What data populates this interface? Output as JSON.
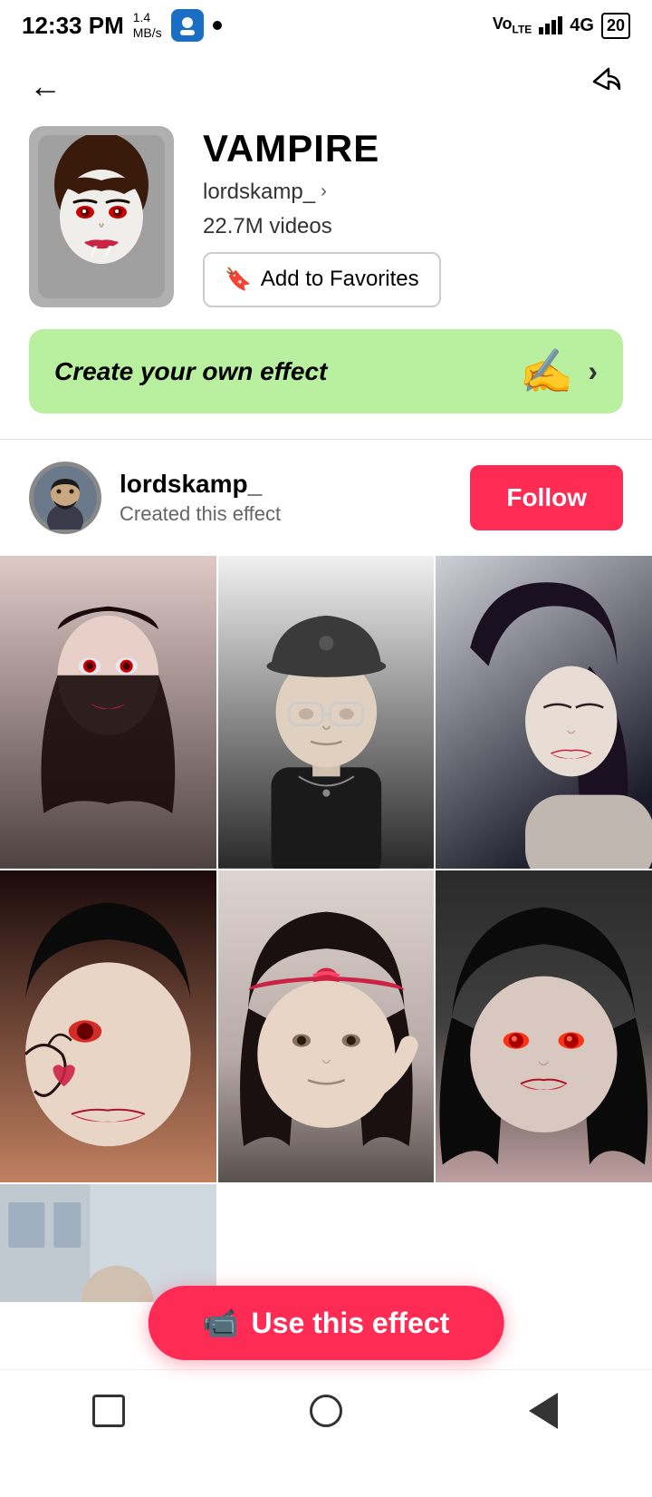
{
  "statusBar": {
    "time": "12:33 PM",
    "speed": "1.4\nMB/s",
    "network": "4G",
    "battery": "20"
  },
  "nav": {
    "back": "←",
    "share": "⇗"
  },
  "effect": {
    "name": "VAMPIRE",
    "creator": "lordskamp_",
    "videos": "22.7M videos",
    "favoritesLabel": "Add to Favorites"
  },
  "banner": {
    "text": "Create your own effect"
  },
  "creator": {
    "username": "lordskamp_",
    "subtitle": "Created this effect",
    "followLabel": "Follow"
  },
  "useEffect": {
    "label": "Use this effect"
  },
  "bottomNav": {
    "square": "stop",
    "circle": "home",
    "triangle": "back"
  }
}
